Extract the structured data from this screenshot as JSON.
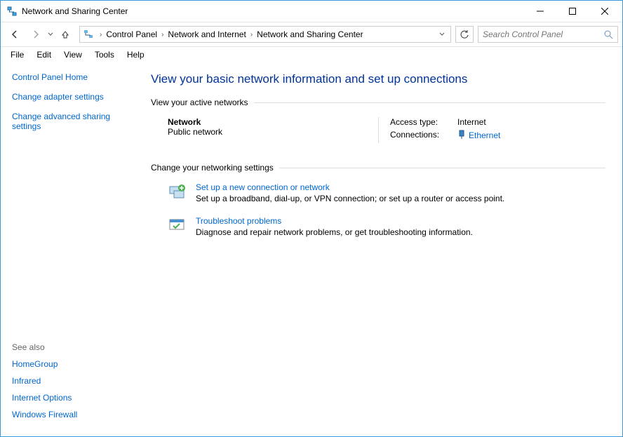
{
  "window": {
    "title": "Network and Sharing Center"
  },
  "breadcrumb": [
    "Control Panel",
    "Network and Internet",
    "Network and Sharing Center"
  ],
  "search": {
    "placeholder": "Search Control Panel"
  },
  "menu": [
    "File",
    "Edit",
    "View",
    "Tools",
    "Help"
  ],
  "sidebar": {
    "links": [
      "Control Panel Home",
      "Change adapter settings",
      "Change advanced sharing settings"
    ],
    "seealso_header": "See also",
    "seealso": [
      "HomeGroup",
      "Infrared",
      "Internet Options",
      "Windows Firewall"
    ]
  },
  "main": {
    "heading": "View your basic network information and set up connections",
    "active_networks_header": "View your active networks",
    "network": {
      "name": "Network",
      "type": "Public network",
      "access_label": "Access type:",
      "access_value": "Internet",
      "connections_label": "Connections:",
      "connections_value": "Ethernet"
    },
    "change_settings_header": "Change your networking settings",
    "tasks": [
      {
        "title": "Set up a new connection or network",
        "desc": "Set up a broadband, dial-up, or VPN connection; or set up a router or access point."
      },
      {
        "title": "Troubleshoot problems",
        "desc": "Diagnose and repair network problems, or get troubleshooting information."
      }
    ]
  }
}
